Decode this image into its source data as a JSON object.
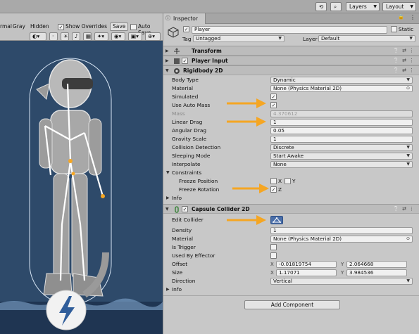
{
  "top_toolbar": {
    "layers_label": "Layers",
    "layout_label": "Layout"
  },
  "scene_toolbar": {
    "normal_label": "rmal",
    "gray_label": "Gray",
    "hidden_label": "Hidden",
    "show_overrides_label": "Show Overrides",
    "save_label": "Save",
    "auto_save_label": "Auto Save"
  },
  "inspector": {
    "tab_label": "Inspector",
    "object_name": "Player",
    "static_label": "Static",
    "tag_label": "Tag",
    "tag_value": "Untagged",
    "layer_label": "Layer",
    "layer_value": "Default",
    "transform_title": "Transform",
    "player_input_title": "Player Input",
    "rigidbody": {
      "title": "Rigidbody 2D",
      "body_type_label": "Body Type",
      "body_type_value": "Dynamic",
      "material_label": "Material",
      "material_value": "None (Physics Material 2D)",
      "simulated_label": "Simulated",
      "auto_mass_label": "Use Auto Mass",
      "mass_label": "Mass",
      "mass_value": "4.370612",
      "linear_drag_label": "Linear Drag",
      "linear_drag_value": "1",
      "angular_drag_label": "Angular Drag",
      "angular_drag_value": "0.05",
      "gravity_label": "Gravity Scale",
      "gravity_value": "1",
      "collision_label": "Collision Detection",
      "collision_value": "Discrete",
      "sleeping_label": "Sleeping Mode",
      "sleeping_value": "Start Awake",
      "interpolate_label": "Interpolate",
      "interpolate_value": "None",
      "constraints_label": "Constraints",
      "freeze_pos_label": "Freeze Position",
      "freeze_rot_label": "Freeze Rotation",
      "x_label": "X",
      "y_label": "Y",
      "z_label": "Z",
      "info_label": "Info"
    },
    "capsule": {
      "title": "Capsule Collider 2D",
      "edit_collider_label": "Edit Collider",
      "density_label": "Density",
      "density_value": "1",
      "material_label": "Material",
      "material_value": "None (Physics Material 2D)",
      "trigger_label": "Is Trigger",
      "effector_label": "Used By Effector",
      "offset_label": "Offset",
      "offset_x": "-0.01819754",
      "offset_y": "2.064668",
      "size_label": "Size",
      "size_x": "1.17071",
      "size_y": "3.984536",
      "direction_label": "Direction",
      "direction_value": "Vertical",
      "info_label": "Info"
    },
    "add_component_label": "Add Component"
  },
  "colors": {
    "highlight_arrow": "#f5a623",
    "scene_bg": "#2e4a6a",
    "selection": "#3a8ff0"
  }
}
